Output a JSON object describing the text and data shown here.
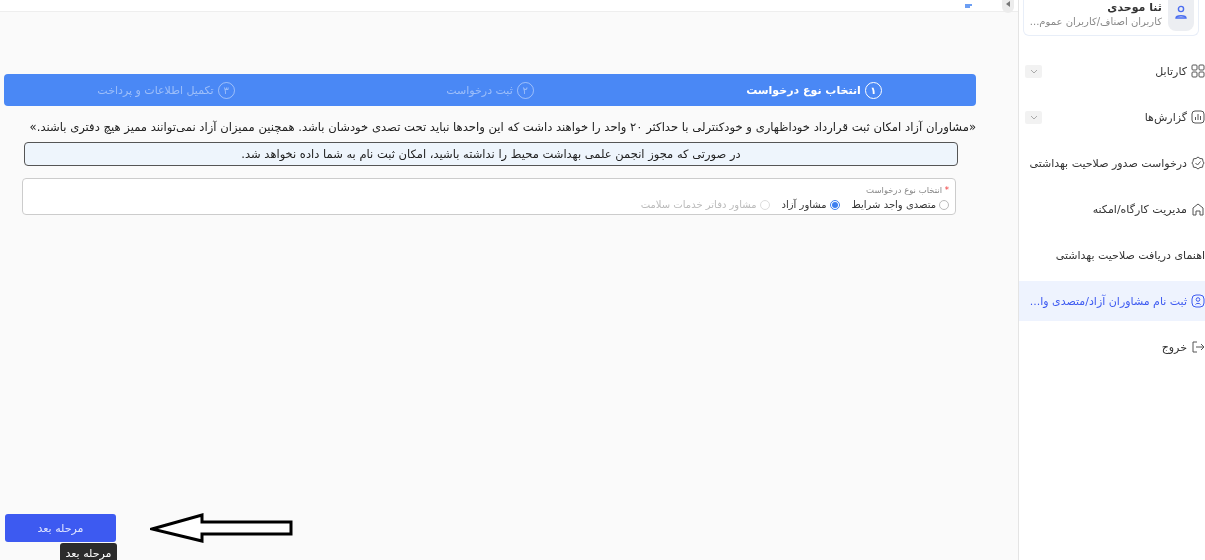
{
  "user": {
    "name": "ثنا موحدی",
    "role": "کاربران اصناف/کاربران عموم..."
  },
  "sidebar": {
    "items": [
      {
        "label": "کارتابل",
        "kind": "grid",
        "expandable": true,
        "selected": false
      },
      {
        "label": "گزارش‌ها",
        "kind": "chart",
        "expandable": true,
        "selected": false
      },
      {
        "label": "درخواست صدور صلاحیت بهداشتی",
        "kind": "badge",
        "expandable": false,
        "selected": false
      },
      {
        "label": "مدیریت کارگاه/امکنه",
        "kind": "home",
        "expandable": false,
        "selected": false
      },
      {
        "label": "اهنمای دریافت صلاحیت بهداشتی",
        "kind": "none",
        "expandable": false,
        "selected": false
      },
      {
        "label": "ثبت نام مشاوران آزاد/متصدی وا...",
        "kind": "user",
        "expandable": false,
        "selected": true
      },
      {
        "label": "خروج",
        "kind": "logout",
        "expandable": false,
        "selected": false
      }
    ]
  },
  "steps": [
    {
      "number": "۱",
      "label": "انتخاب نوع درخواست",
      "selected": true
    },
    {
      "number": "۲",
      "label": "ثبت درخواست",
      "selected": false
    },
    {
      "number": "۳",
      "label": "تکمیل اطلاعات و پرداخت",
      "selected": false
    }
  ],
  "description": "«مشاوران آزاد امکان ثبت قرارداد خوداظهاری و خودکنترلی با حداکثر ۲۰ واحد را خواهند داشت که این واحدها نباید تحت تصدی خودشان باشد. همچنین ممیزان آزاد نمی‌توانند ممیز هیچ دفتری باشند.»",
  "notice": "در صورتی که مجوز انجمن علمی بهداشت محیط را نداشته باشید، امکان ثبت نام به شما داده نخواهد شد.",
  "request_type": {
    "label": "انتخاب نوع درخواست",
    "required_mark": "*",
    "options": [
      {
        "label": "متصدی واجد شرایط",
        "selected": false,
        "disabled": false
      },
      {
        "label": "مشاور آزاد",
        "selected": true,
        "disabled": false
      },
      {
        "label": "مشاور دفاتر خدمات سلامت",
        "selected": false,
        "disabled": true
      }
    ]
  },
  "next_button": "مرحله بعد",
  "tooltip": "مرحله بعد"
}
